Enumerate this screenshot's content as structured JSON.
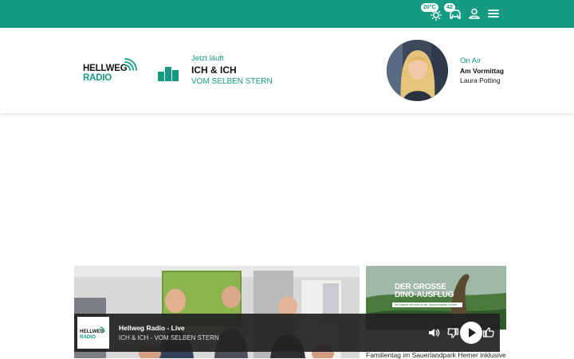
{
  "topbar": {
    "weather": {
      "temp": "20°C",
      "icon": "sun-icon"
    },
    "traffic": {
      "count": "42",
      "icon": "car-icon"
    },
    "account_icon": "user-icon",
    "menu_icon": "menu-icon",
    "color": "#169a82"
  },
  "brand": {
    "line1": "HELLWEG",
    "line2": "RADIO"
  },
  "now_playing": {
    "label": "Jetzt läuft",
    "artist": "ICH & ICH",
    "title": "VOM SELBEN STERN",
    "icon": "equalizer-icon"
  },
  "on_air": {
    "label": "On Air",
    "show": "Am Vormittag",
    "host": "Laura Potting"
  },
  "teasers": {
    "promo_title_1": "DER GROSSE",
    "promo_title_2": "DINO-AUSFLUG",
    "promo_strip": "Mit Sabeth mit euch in der Sauerlandpark Hemer",
    "right_caption": "Familientag im Sauerlandpark Hemer inklusive"
  },
  "player": {
    "station": "Hellweg Radio - Live",
    "track": "ICH & ICH - VOM SELBEN STERN",
    "logo_line1": "HELLWEG",
    "logo_line2": "RADIO",
    "icons": [
      "volume-icon",
      "thumbs-down-icon",
      "play-icon",
      "thumbs-up-icon"
    ]
  }
}
